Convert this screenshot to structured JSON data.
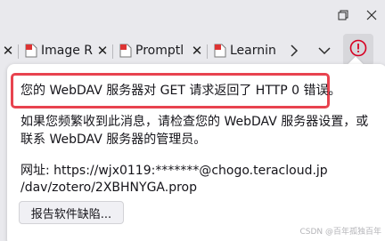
{
  "window": {
    "controls": [
      "restore-icon",
      "close-icon"
    ]
  },
  "tabs": [
    {
      "label": "Image R",
      "icon": "document-icon"
    },
    {
      "label": "Promptl",
      "icon": "document-icon"
    },
    {
      "label": "Learning",
      "icon": "document-icon"
    }
  ],
  "toolbar": {
    "next_icon": "chevron-right-icon",
    "menu_icon": "chevron-down-icon",
    "alert_icon": "warning-icon",
    "accent": "#d70022"
  },
  "popup": {
    "headline": "您的 WebDAV 服务器对 GET 请求返回了 HTTP 0 错误。",
    "advice_line1": "如果您频繁收到此消息，请检查您的 WebDAV 服务器设置，或",
    "advice_line2": "联系 WebDAV 服务器的管理员。",
    "url_line1": "网址: https://wjx0119:*******@chogo.teracloud.jp",
    "url_line2": "/dav/zotero/2XBHNYGA.prop",
    "report_button": "报告软件缺陷...",
    "highlight_color": "#e8434f"
  },
  "watermark": "CSDN @百年孤独百年"
}
